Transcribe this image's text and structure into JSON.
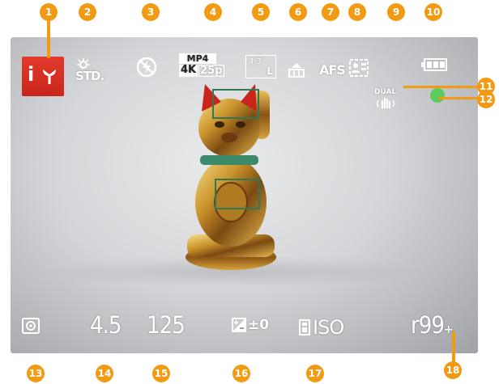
{
  "top_bar": {
    "mode_icon": "intelligent-auto-red-mode-icon",
    "photo_style": "STD.",
    "flash_icon": "flash-off-icon",
    "rec_format": "MP4",
    "rec_quality": [
      "4K",
      "25p"
    ],
    "aspect_ratio": "4:3",
    "picture_size": "L",
    "quality_icon": "fine-quality-icon",
    "focus_mode": "AFS",
    "af_mode_icon": "face-detection-icon",
    "battery_icon": "battery-full-icon"
  },
  "side": {
    "stabilizer_label": "DUAL",
    "stabilizer_icon": "stabilizer-hand-icon",
    "focus_indicator_color": "#5ccc5c"
  },
  "bottom_bar": {
    "metering_icon": "metering-mode-icon",
    "aperture": "4.5",
    "shutter_speed": "125",
    "exposure_comp": "±0",
    "iso": "ISO",
    "remaining_shots": "r99",
    "remaining_plus": "+"
  },
  "callouts": [
    "1",
    "2",
    "3",
    "4",
    "5",
    "6",
    "7",
    "8",
    "9",
    "10",
    "11",
    "12",
    "13",
    "14",
    "15",
    "16",
    "17",
    "18"
  ],
  "colors": {
    "callout": "#f29a12",
    "mode_red": "#d32d20",
    "focus_box": "#2f7a55",
    "indicator": "#5ccc5c"
  }
}
